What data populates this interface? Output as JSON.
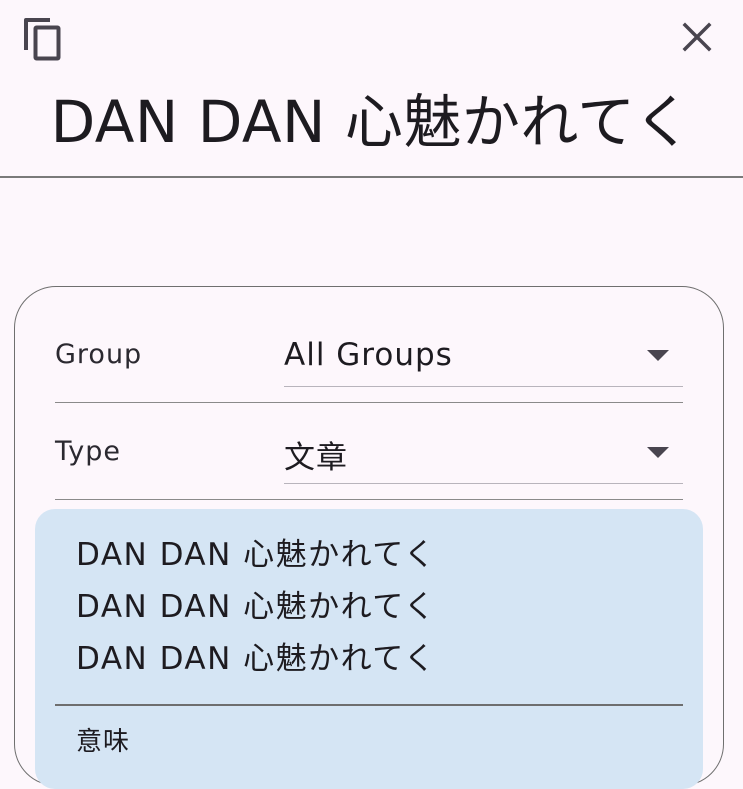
{
  "header": {
    "title": "DAN DAN 心魅かれてく",
    "copy_icon": "copy-icon",
    "close_icon": "close-icon"
  },
  "filters": {
    "group": {
      "label": "Group",
      "value": "All Groups"
    },
    "type": {
      "label": "Type",
      "value": "文章"
    }
  },
  "sentences": [
    "DAN DAN 心魅かれてく",
    "DAN DAN 心魅かれてく",
    "DAN DAN 心魅かれてく"
  ],
  "meaning_label": "意味",
  "colors": {
    "background": "#fdf7fc",
    "sentence_card": "#d5e5f4",
    "divider": "#7a7a7a"
  }
}
